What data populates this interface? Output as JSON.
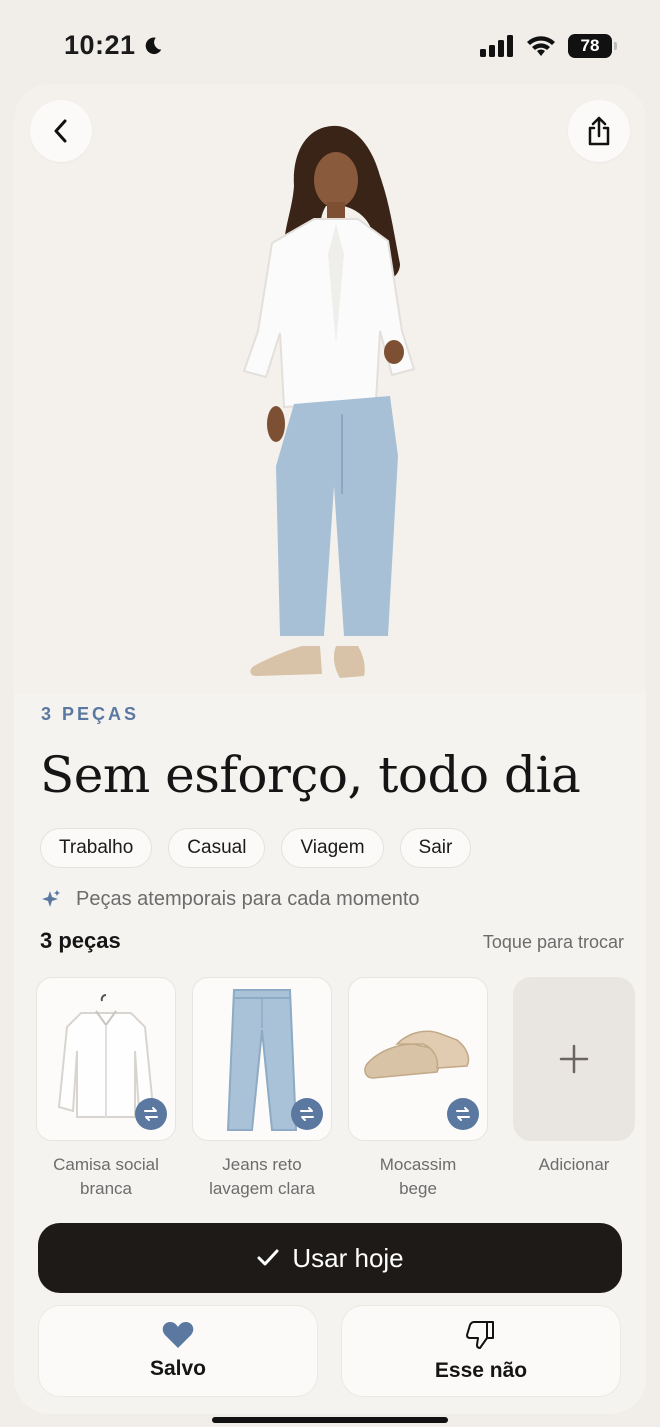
{
  "status_bar": {
    "time": "10:21",
    "battery": "78"
  },
  "outfit": {
    "pieces_count": "3 PEÇAS",
    "title": "Sem esforço, todo dia",
    "tags": [
      "Trabalho",
      "Casual",
      "Viagem",
      "Sair"
    ],
    "subtitle": "Peças atemporais para cada momento"
  },
  "pieces": {
    "header": "3 peças",
    "hint": "Toque para trocar",
    "items": [
      {
        "label_line1": "Camisa social",
        "label_line2": "branca",
        "icon": "white-shirt"
      },
      {
        "label_line1": "Jeans reto",
        "label_line2": "lavagem clara",
        "icon": "jeans"
      },
      {
        "label_line1": "Mocassim",
        "label_line2": "bege",
        "icon": "loafers"
      }
    ],
    "add_label": "Adicionar"
  },
  "actions": {
    "primary": "Usar hoje",
    "saved": "Salvo",
    "reject": "Esse não"
  },
  "colors": {
    "accent": "#5a78a0",
    "primary_button": "#1d1a17",
    "background": "#f1eeea"
  }
}
